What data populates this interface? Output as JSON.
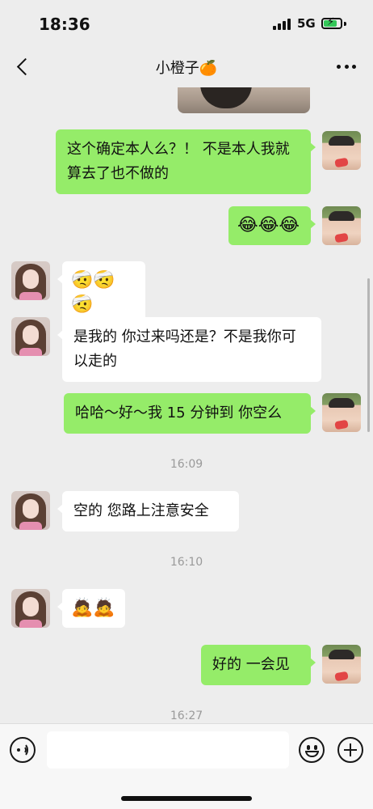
{
  "status_bar": {
    "time": "18:36",
    "network": "5G",
    "battery_level": 0.8,
    "charging": true,
    "signal_icon": "cellular-signal-icon",
    "battery_icon": "battery-charging-icon"
  },
  "nav": {
    "title": "小橙子🍊",
    "back_icon": "chevron-left-icon",
    "more_icon": "more-dots-icon"
  },
  "messages": [
    {
      "sender": "me",
      "type": "image"
    },
    {
      "sender": "me",
      "type": "text",
      "text": "这个确定本人么？！ 不是本人我就算去了也不做的"
    },
    {
      "sender": "me",
      "type": "emoji",
      "text": "😂😂😂"
    },
    {
      "sender": "her",
      "type": "emoji",
      "text": "🤕🤕🤕"
    },
    {
      "sender": "her",
      "type": "text",
      "text": "是我的 你过来吗还是？不是我你可以走的"
    },
    {
      "sender": "me",
      "type": "text",
      "text": "哈哈～好～我 15 分钟到 你空么"
    },
    {
      "type": "timestamp",
      "text": "16:09"
    },
    {
      "sender": "her",
      "type": "text",
      "text": "空的 您路上注意安全"
    },
    {
      "type": "timestamp",
      "text": "16:10"
    },
    {
      "sender": "her",
      "type": "emoji",
      "text": "🙇🙇"
    },
    {
      "sender": "me",
      "type": "text",
      "text": "好的 一会见"
    },
    {
      "type": "timestamp",
      "text": "16:27"
    }
  ],
  "input_bar": {
    "placeholder": "",
    "voice_icon": "voice-icon",
    "emoji_icon": "emoji-smile-icon",
    "plus_icon": "plus-circle-icon"
  },
  "colors": {
    "background": "#ededed",
    "my_bubble": "#95ec69",
    "their_bubble": "#ffffff",
    "timestamp": "#9a9a9a"
  }
}
